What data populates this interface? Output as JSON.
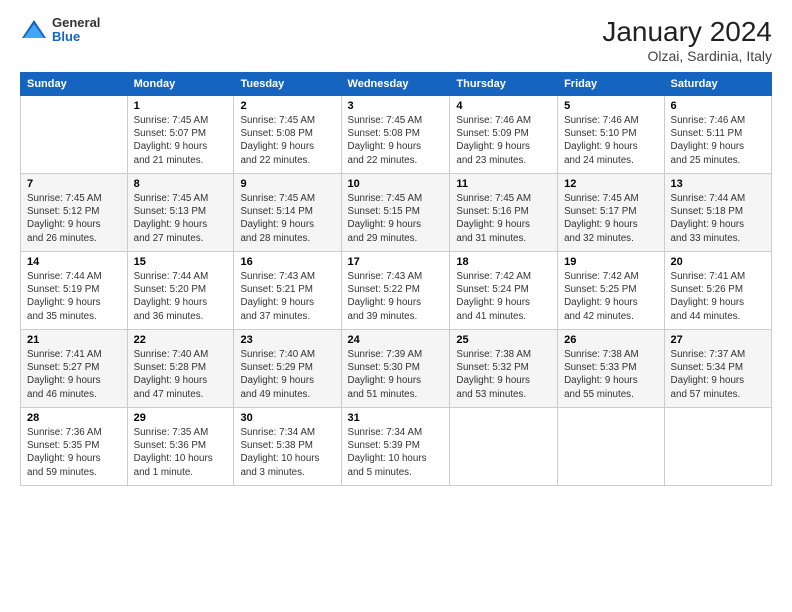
{
  "logo": {
    "general": "General",
    "blue": "Blue"
  },
  "title": "January 2024",
  "subtitle": "Olzai, Sardinia, Italy",
  "days_header": [
    "Sunday",
    "Monday",
    "Tuesday",
    "Wednesday",
    "Thursday",
    "Friday",
    "Saturday"
  ],
  "weeks": [
    [
      {
        "num": "",
        "info": ""
      },
      {
        "num": "1",
        "info": "Sunrise: 7:45 AM\nSunset: 5:07 PM\nDaylight: 9 hours\nand 21 minutes."
      },
      {
        "num": "2",
        "info": "Sunrise: 7:45 AM\nSunset: 5:08 PM\nDaylight: 9 hours\nand 22 minutes."
      },
      {
        "num": "3",
        "info": "Sunrise: 7:45 AM\nSunset: 5:08 PM\nDaylight: 9 hours\nand 22 minutes."
      },
      {
        "num": "4",
        "info": "Sunrise: 7:46 AM\nSunset: 5:09 PM\nDaylight: 9 hours\nand 23 minutes."
      },
      {
        "num": "5",
        "info": "Sunrise: 7:46 AM\nSunset: 5:10 PM\nDaylight: 9 hours\nand 24 minutes."
      },
      {
        "num": "6",
        "info": "Sunrise: 7:46 AM\nSunset: 5:11 PM\nDaylight: 9 hours\nand 25 minutes."
      }
    ],
    [
      {
        "num": "7",
        "info": "Sunrise: 7:45 AM\nSunset: 5:12 PM\nDaylight: 9 hours\nand 26 minutes."
      },
      {
        "num": "8",
        "info": "Sunrise: 7:45 AM\nSunset: 5:13 PM\nDaylight: 9 hours\nand 27 minutes."
      },
      {
        "num": "9",
        "info": "Sunrise: 7:45 AM\nSunset: 5:14 PM\nDaylight: 9 hours\nand 28 minutes."
      },
      {
        "num": "10",
        "info": "Sunrise: 7:45 AM\nSunset: 5:15 PM\nDaylight: 9 hours\nand 29 minutes."
      },
      {
        "num": "11",
        "info": "Sunrise: 7:45 AM\nSunset: 5:16 PM\nDaylight: 9 hours\nand 31 minutes."
      },
      {
        "num": "12",
        "info": "Sunrise: 7:45 AM\nSunset: 5:17 PM\nDaylight: 9 hours\nand 32 minutes."
      },
      {
        "num": "13",
        "info": "Sunrise: 7:44 AM\nSunset: 5:18 PM\nDaylight: 9 hours\nand 33 minutes."
      }
    ],
    [
      {
        "num": "14",
        "info": "Sunrise: 7:44 AM\nSunset: 5:19 PM\nDaylight: 9 hours\nand 35 minutes."
      },
      {
        "num": "15",
        "info": "Sunrise: 7:44 AM\nSunset: 5:20 PM\nDaylight: 9 hours\nand 36 minutes."
      },
      {
        "num": "16",
        "info": "Sunrise: 7:43 AM\nSunset: 5:21 PM\nDaylight: 9 hours\nand 37 minutes."
      },
      {
        "num": "17",
        "info": "Sunrise: 7:43 AM\nSunset: 5:22 PM\nDaylight: 9 hours\nand 39 minutes."
      },
      {
        "num": "18",
        "info": "Sunrise: 7:42 AM\nSunset: 5:24 PM\nDaylight: 9 hours\nand 41 minutes."
      },
      {
        "num": "19",
        "info": "Sunrise: 7:42 AM\nSunset: 5:25 PM\nDaylight: 9 hours\nand 42 minutes."
      },
      {
        "num": "20",
        "info": "Sunrise: 7:41 AM\nSunset: 5:26 PM\nDaylight: 9 hours\nand 44 minutes."
      }
    ],
    [
      {
        "num": "21",
        "info": "Sunrise: 7:41 AM\nSunset: 5:27 PM\nDaylight: 9 hours\nand 46 minutes."
      },
      {
        "num": "22",
        "info": "Sunrise: 7:40 AM\nSunset: 5:28 PM\nDaylight: 9 hours\nand 47 minutes."
      },
      {
        "num": "23",
        "info": "Sunrise: 7:40 AM\nSunset: 5:29 PM\nDaylight: 9 hours\nand 49 minutes."
      },
      {
        "num": "24",
        "info": "Sunrise: 7:39 AM\nSunset: 5:30 PM\nDaylight: 9 hours\nand 51 minutes."
      },
      {
        "num": "25",
        "info": "Sunrise: 7:38 AM\nSunset: 5:32 PM\nDaylight: 9 hours\nand 53 minutes."
      },
      {
        "num": "26",
        "info": "Sunrise: 7:38 AM\nSunset: 5:33 PM\nDaylight: 9 hours\nand 55 minutes."
      },
      {
        "num": "27",
        "info": "Sunrise: 7:37 AM\nSunset: 5:34 PM\nDaylight: 9 hours\nand 57 minutes."
      }
    ],
    [
      {
        "num": "28",
        "info": "Sunrise: 7:36 AM\nSunset: 5:35 PM\nDaylight: 9 hours\nand 59 minutes."
      },
      {
        "num": "29",
        "info": "Sunrise: 7:35 AM\nSunset: 5:36 PM\nDaylight: 10 hours\nand 1 minute."
      },
      {
        "num": "30",
        "info": "Sunrise: 7:34 AM\nSunset: 5:38 PM\nDaylight: 10 hours\nand 3 minutes."
      },
      {
        "num": "31",
        "info": "Sunrise: 7:34 AM\nSunset: 5:39 PM\nDaylight: 10 hours\nand 5 minutes."
      },
      {
        "num": "",
        "info": ""
      },
      {
        "num": "",
        "info": ""
      },
      {
        "num": "",
        "info": ""
      }
    ]
  ]
}
